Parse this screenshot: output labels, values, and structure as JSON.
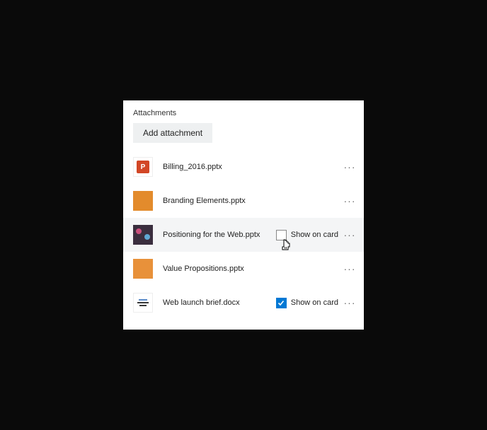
{
  "section": {
    "title": "Attachments",
    "add_label": "Add attachment"
  },
  "show_label": "Show on card",
  "attachments": [
    {
      "name": "Billing_2016.pptx",
      "thumb": "pp",
      "hovered": false,
      "show_visible": false,
      "checked": false
    },
    {
      "name": "Branding Elements.pptx",
      "thumb": "orange",
      "hovered": false,
      "show_visible": false,
      "checked": false
    },
    {
      "name": "Positioning for the Web.pptx",
      "thumb": "dark",
      "hovered": true,
      "show_visible": true,
      "checked": false,
      "cursor": true
    },
    {
      "name": "Value Propositions.pptx",
      "thumb": "orange2",
      "hovered": false,
      "show_visible": false,
      "checked": false
    },
    {
      "name": "Web launch brief.docx",
      "thumb": "doc",
      "hovered": false,
      "show_visible": true,
      "checked": true
    }
  ]
}
